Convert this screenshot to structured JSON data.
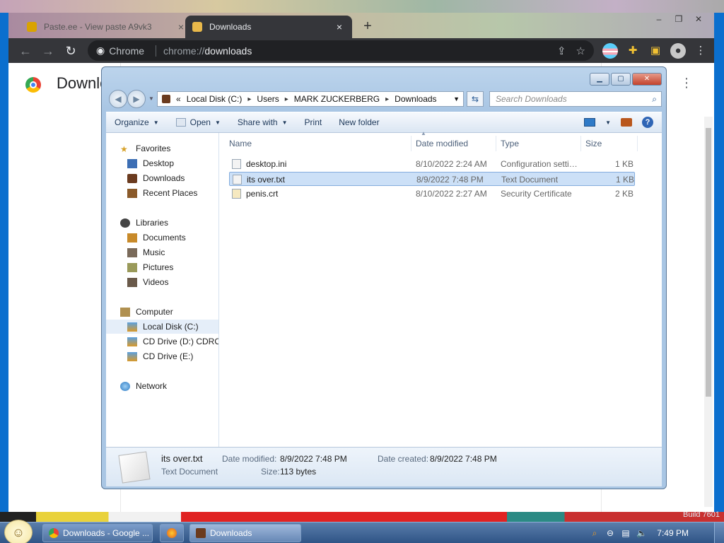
{
  "chrome": {
    "tabs": [
      {
        "title": "Paste.ee - View paste A9vk3",
        "close": "×"
      },
      {
        "title": "Downloads",
        "close": "×"
      }
    ],
    "new_tab": "+",
    "window_controls": {
      "minimize": "–",
      "maximize": "❐",
      "close": "✕"
    },
    "nav": {
      "back": "←",
      "forward": "→",
      "reload": "↻"
    },
    "omnibox": {
      "chip": "Chrome",
      "scheme": "chrome://",
      "host": "downloads"
    },
    "page": {
      "heading": "Downloads",
      "menu": "⋮"
    }
  },
  "explorer": {
    "caption": {
      "minimize": "▁",
      "maximize": "▢",
      "close": "✕"
    },
    "address": {
      "overflow": "«",
      "crumbs": [
        "Local Disk (C:)",
        "Users",
        "MARK ZUCKERBERG",
        "Downloads"
      ],
      "separator": "▸"
    },
    "search_placeholder": "Search Downloads",
    "toolbar": {
      "organize": "Organize",
      "open": "Open",
      "share_with": "Share with",
      "print": "Print",
      "new_folder": "New folder"
    },
    "nav": {
      "favorites": "Favorites",
      "favorites_items": [
        "Desktop",
        "Downloads",
        "Recent Places"
      ],
      "libraries": "Libraries",
      "libraries_items": [
        "Documents",
        "Music",
        "Pictures",
        "Videos"
      ],
      "computer": "Computer",
      "computer_items": [
        "Local Disk (C:)",
        "CD Drive (D:) CDROM",
        "CD Drive (E:)"
      ],
      "network": "Network"
    },
    "columns": {
      "name": "Name",
      "date": "Date modified",
      "type": "Type",
      "size": "Size"
    },
    "files": [
      {
        "name": "desktop.ini",
        "date": "8/10/2022 2:24 AM",
        "type": "Configuration settings",
        "size": "1 KB"
      },
      {
        "name": "its over.txt",
        "date": "8/9/2022 7:48 PM",
        "type": "Text Document",
        "size": "1 KB"
      },
      {
        "name": "penis.crt",
        "date": "8/10/2022 2:27 AM",
        "type": "Security Certificate",
        "size": "2 KB"
      }
    ],
    "details": {
      "filename": "its over.txt",
      "filetype": "Text Document",
      "modified_label": "Date modified:",
      "modified_value": "8/9/2022 7:48 PM",
      "created_label": "Date created:",
      "created_value": "8/9/2022 7:48 PM",
      "size_label": "Size:",
      "size_value": "113 bytes"
    }
  },
  "taskbar": {
    "buttons": [
      "Downloads - Google ...",
      "Downloads"
    ],
    "clock": "7:49 PM",
    "build": "Build 7601"
  },
  "colors": {
    "chrome_dark": "#35363a",
    "selection": "#cce0f7",
    "desktop": "#0b6fce"
  }
}
